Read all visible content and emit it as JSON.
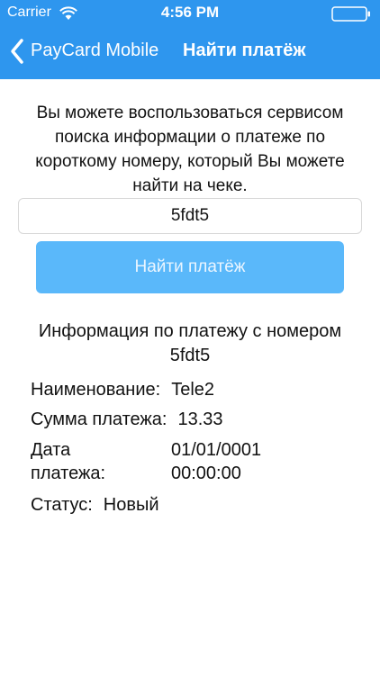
{
  "status_bar": {
    "carrier": "Carrier",
    "time": "4:56 PM",
    "wifi_icon": "wifi-icon",
    "battery_icon": "battery-icon"
  },
  "nav": {
    "back_label": "PayCard Mobile",
    "title": "Найти платёж",
    "back_icon": "chevron-left-icon"
  },
  "colors": {
    "nav_bg": "#2e96ee",
    "button_bg": "#5ab8fa",
    "text": "#111111"
  },
  "intro_text": "Вы можете воспользоваться сервисом поиска информации о платеже по короткому номеру, который Вы можете найти на чеке.",
  "search": {
    "value": "5fdt5"
  },
  "find_button_label": "Найти платёж",
  "info": {
    "title": "Информация по платежу с номером 5fdt5",
    "name_label": "Наименование:",
    "name_value": "Tele2",
    "amount_label": "Сумма платежа:",
    "amount_value": "13.33",
    "date_label": "Дата платежа:",
    "date_value": "01/01/0001 00:00:00",
    "status_label": "Статус:",
    "status_value": "Новый"
  }
}
